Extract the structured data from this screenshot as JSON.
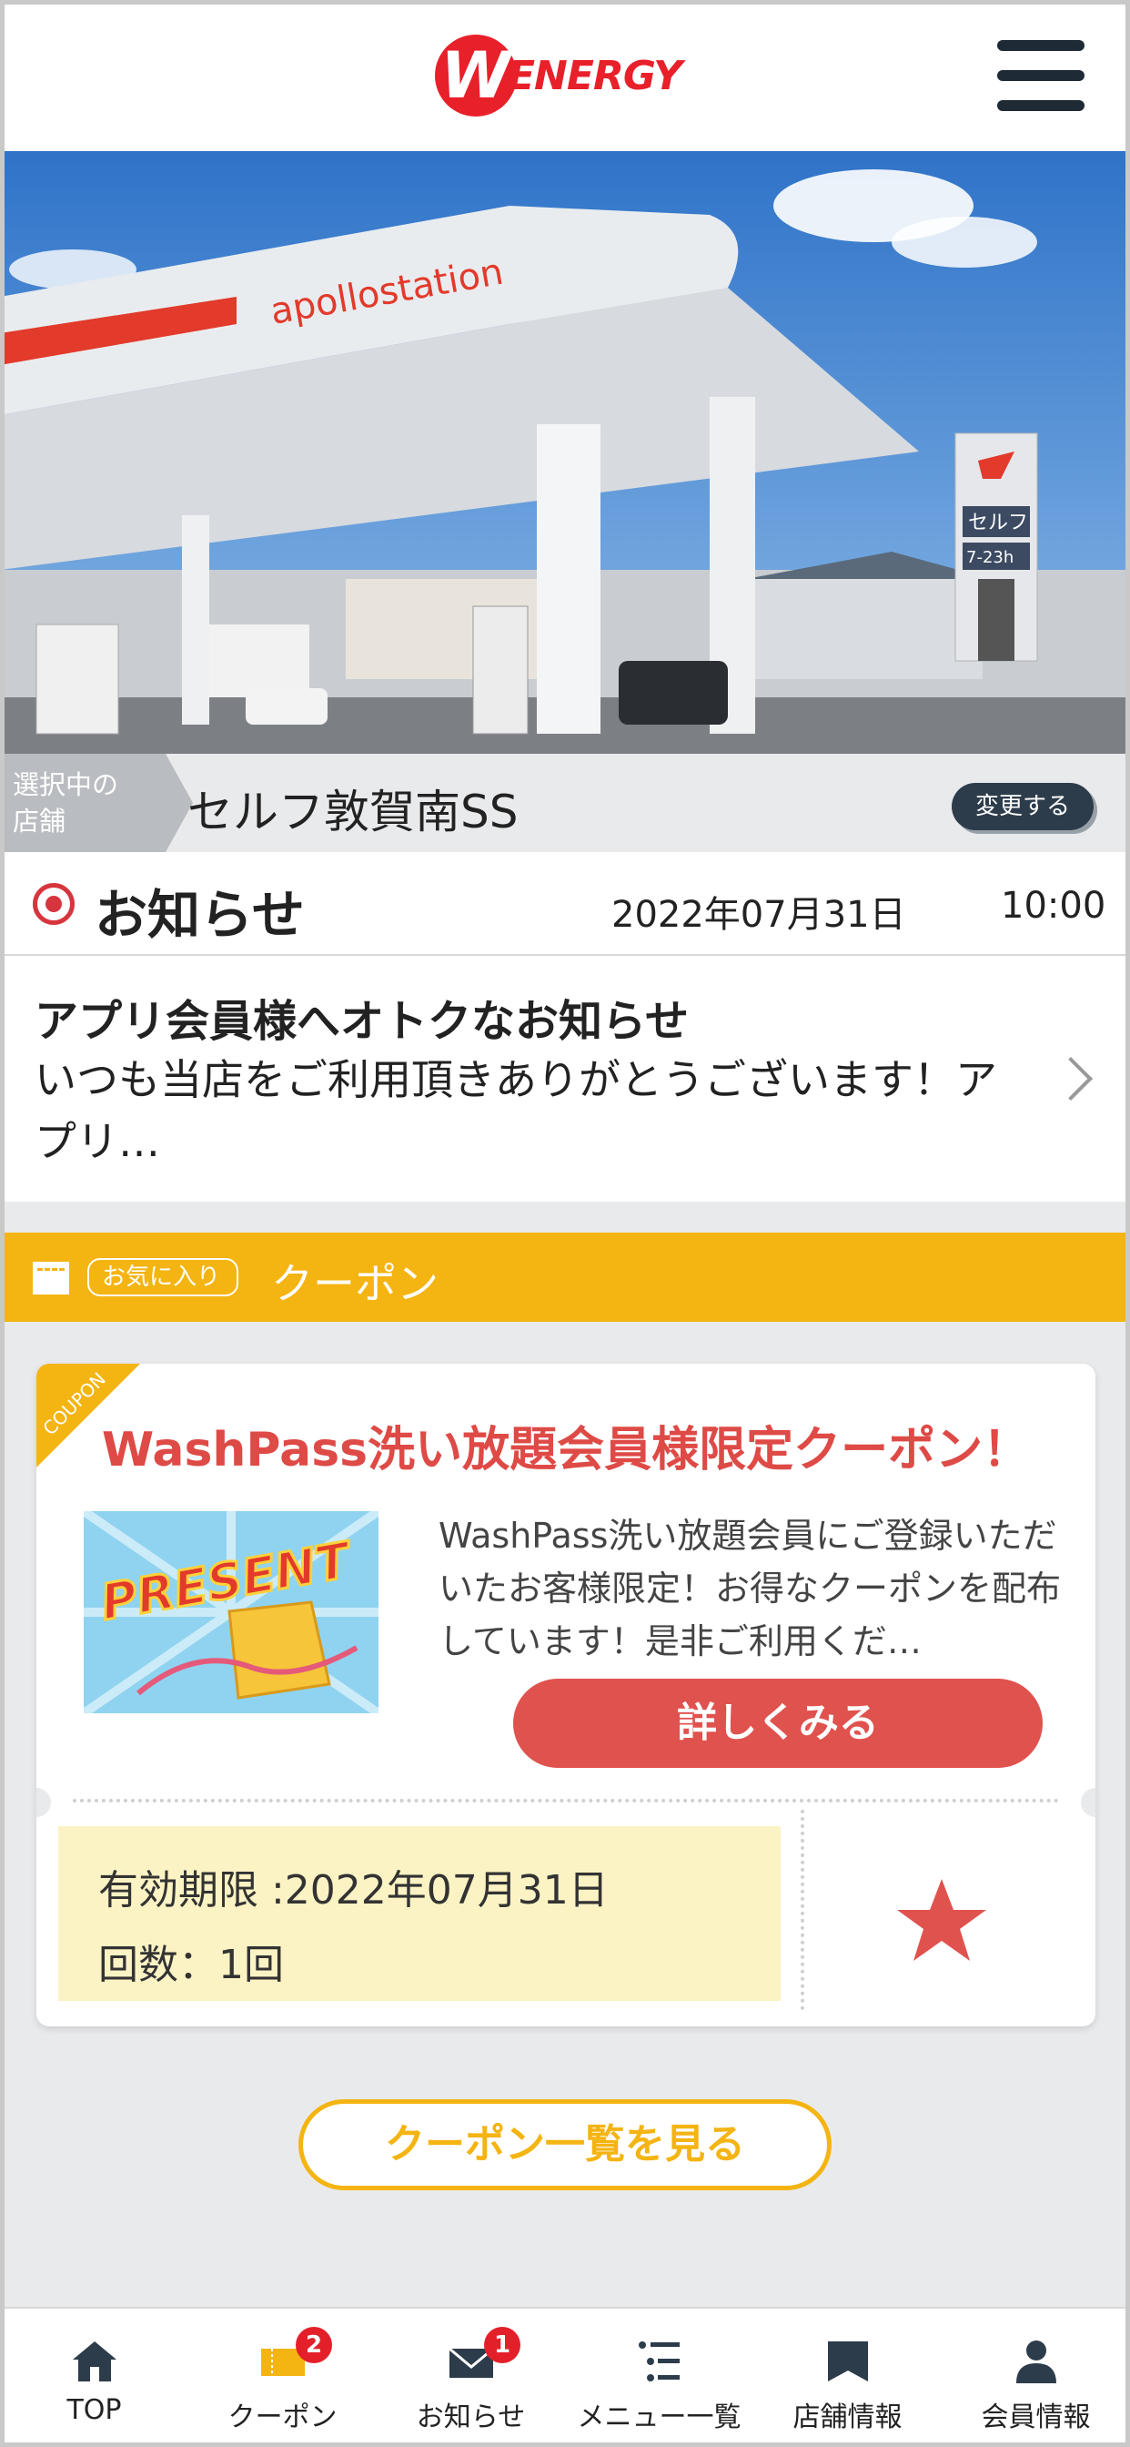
{
  "header": {
    "logo_text": "ENERGY",
    "logo_mark": "W"
  },
  "store": {
    "tag_line1": "選択中の",
    "tag_line2": "店舗",
    "name": "セルフ敦賀南SS",
    "change_label": "変更する"
  },
  "hero": {
    "canopy_sign": "apollostation",
    "pole_sign_1": "セルフ",
    "pole_sign_2": "7-23h"
  },
  "news": {
    "title": "お知らせ",
    "date": "2022年07月31日",
    "time": "10:00",
    "item_title": "アプリ会員様へオトクなお知らせ",
    "item_body": "いつも当店をご利用頂きありがとうございます！アプリ…"
  },
  "coupon_section": {
    "fav_tag": "お気に入り",
    "title": "クーポン"
  },
  "coupon": {
    "corner_label": "COUPON",
    "title": "WashPass洗い放題会員様限定クーポン！",
    "image_text": "PRESENT",
    "description": "WashPass洗い放題会員にご登録いただいたお客様限定！お得なクーポンを配布しています！是非ご利用くだ…",
    "detail_button": "詳しくみる",
    "expiry": "有効期限 :2022年07月31日",
    "count": "回数：1回"
  },
  "list_button": "クーポン一覧を見る",
  "tabs": [
    {
      "label": "TOP",
      "icon": "home-icon"
    },
    {
      "label": "クーポン",
      "icon": "coupon-icon",
      "badge": "2"
    },
    {
      "label": "お知らせ",
      "icon": "mail-icon",
      "badge": "1"
    },
    {
      "label": "メニュー一覧",
      "icon": "list-icon"
    },
    {
      "label": "店舗情報",
      "icon": "store-icon"
    },
    {
      "label": "会員情報",
      "icon": "person-icon"
    }
  ],
  "colors": {
    "brand_red": "#e8202a",
    "accent_yellow": "#f4b412",
    "button_red": "#e0524e",
    "navy": "#2d3c4b"
  }
}
